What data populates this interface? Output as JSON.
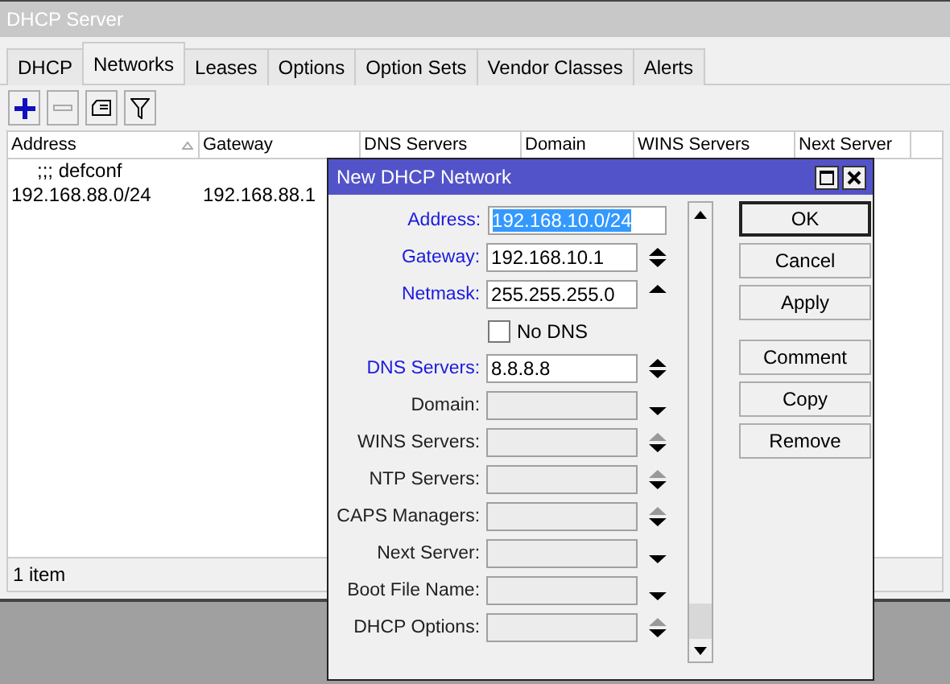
{
  "window": {
    "title": "DHCP Server"
  },
  "tabs": [
    {
      "label": "DHCP",
      "selected": false
    },
    {
      "label": "Networks",
      "selected": true
    },
    {
      "label": "Leases",
      "selected": false
    },
    {
      "label": "Options",
      "selected": false
    },
    {
      "label": "Option Sets",
      "selected": false
    },
    {
      "label": "Vendor Classes",
      "selected": false
    },
    {
      "label": "Alerts",
      "selected": false
    }
  ],
  "toolbar": [
    {
      "kind": "add",
      "disabled": false
    },
    {
      "kind": "remove",
      "disabled": true
    },
    {
      "kind": "comment",
      "disabled": false
    },
    {
      "kind": "filter",
      "disabled": false
    }
  ],
  "table": {
    "columns": [
      {
        "label": "Address",
        "sorted": true
      },
      {
        "label": "Gateway",
        "sorted": false
      },
      {
        "label": "DNS Servers",
        "sorted": false
      },
      {
        "label": "Domain",
        "sorted": false
      },
      {
        "label": "WINS Servers",
        "sorted": false
      },
      {
        "label": "Next Server",
        "sorted": false
      }
    ],
    "rows": [
      {
        "kind": "comment",
        "text": ";;; defconf"
      },
      {
        "kind": "data",
        "cells": [
          "192.168.88.0/24",
          "192.168.88.1"
        ]
      }
    ]
  },
  "status_bar": "1 item",
  "dialog": {
    "title": "New DHCP Network",
    "fields": [
      {
        "kind": "field",
        "label": "Address:",
        "value": "192.168.10.0/24",
        "active": true,
        "highlighted": true,
        "up": false,
        "down": false
      },
      {
        "kind": "field",
        "label": "Gateway:",
        "value": "192.168.10.1",
        "active": true,
        "highlighted": false,
        "up": true,
        "up_disabled": false,
        "down": true
      },
      {
        "kind": "field",
        "label": "Netmask:",
        "value": "255.255.255.0",
        "active": true,
        "highlighted": false,
        "up": true,
        "up_disabled": false,
        "down": false
      },
      {
        "kind": "checkbox",
        "label": "No DNS",
        "checked": false
      },
      {
        "kind": "field",
        "label": "DNS Servers:",
        "value": "8.8.8.8",
        "active": true,
        "highlighted": false,
        "up": true,
        "up_disabled": false,
        "down": true
      },
      {
        "kind": "field",
        "label": "Domain:",
        "active": false,
        "up": false,
        "down": true
      },
      {
        "kind": "field",
        "label": "WINS Servers:",
        "active": false,
        "up": true,
        "up_disabled": true,
        "down": true
      },
      {
        "kind": "field",
        "label": "NTP Servers:",
        "active": false,
        "up": true,
        "up_disabled": true,
        "down": true
      },
      {
        "kind": "field",
        "label": "CAPS Managers:",
        "active": false,
        "up": true,
        "up_disabled": true,
        "down": true
      },
      {
        "kind": "field",
        "label": "Next Server:",
        "active": false,
        "up": false,
        "down": true
      },
      {
        "kind": "field",
        "label": "Boot File Name:",
        "active": false,
        "up": false,
        "down": true
      },
      {
        "kind": "field",
        "label": "DHCP Options:",
        "active": false,
        "up": true,
        "up_disabled": true,
        "down": true
      }
    ],
    "button_groups": [
      [
        {
          "label": "OK",
          "default": true
        },
        {
          "label": "Cancel",
          "default": false
        },
        {
          "label": "Apply",
          "default": false
        }
      ],
      [
        {
          "label": "Comment",
          "default": false
        },
        {
          "label": "Copy",
          "default": false
        },
        {
          "label": "Remove",
          "default": false
        }
      ]
    ]
  }
}
